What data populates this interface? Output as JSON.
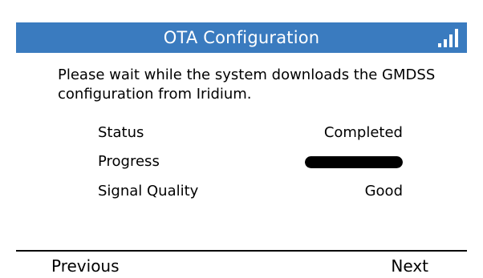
{
  "title_bar": {
    "title": "OTA Configuration",
    "signal_icon": "signal-bars-icon",
    "color": "#3a7bbf"
  },
  "message": "Please wait while the system downloads the GMDSS configuration from Iridium.",
  "details": {
    "status": {
      "label": "Status",
      "value": "Completed"
    },
    "progress": {
      "label": "Progress",
      "percent": 100
    },
    "signal_quality": {
      "label": "Signal Quality",
      "value": "Good"
    }
  },
  "softkeys": {
    "left": "Previous",
    "right": "Next"
  }
}
